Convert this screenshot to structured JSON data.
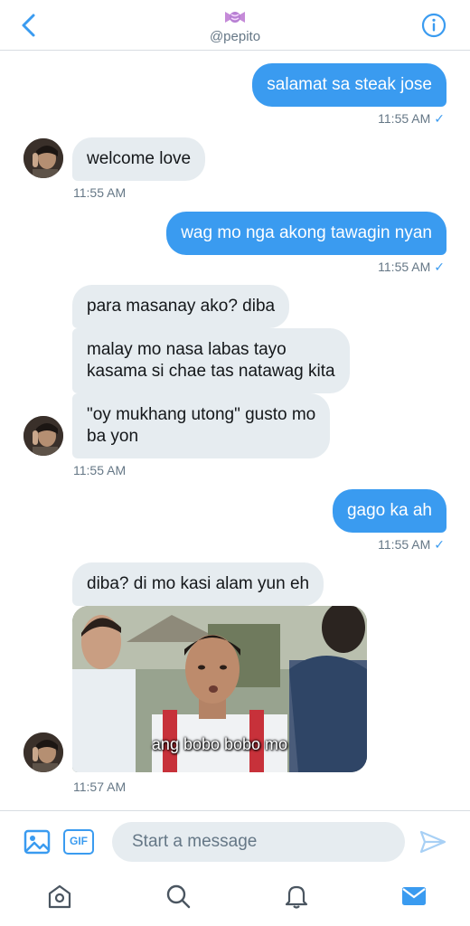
{
  "header": {
    "handle": "@pepito",
    "avatar_icon": "candy-emoji-icon"
  },
  "messages": [
    {
      "direction": "out",
      "text": "salamat sa steak jose",
      "time": "11:55 AM",
      "read": true
    },
    {
      "direction": "in",
      "text": "welcome love",
      "time": "11:55 AM"
    },
    {
      "direction": "out",
      "text": "wag mo nga akong tawagin nyan",
      "time": "11:55 AM",
      "read": true
    },
    {
      "direction": "in",
      "text": "para masanay ako? diba"
    },
    {
      "direction": "in",
      "lines": [
        "malay mo nasa labas tayo",
        "kasama si chae tas natawag kita"
      ]
    },
    {
      "direction": "in",
      "lines": [
        "\"oy mukhang utong\" gusto mo",
        "ba yon"
      ],
      "time": "11:55 AM"
    },
    {
      "direction": "out",
      "text": "gago ka ah",
      "time": "11:55 AM",
      "read": true
    },
    {
      "direction": "in",
      "text": "diba? di mo kasi alam yun eh"
    },
    {
      "direction": "in",
      "media_caption": "ang bobo bobo mo",
      "time": "11:57 AM"
    }
  ],
  "read_mark": "✓",
  "composer": {
    "placeholder": "Start a message",
    "gif_label": "GIF"
  },
  "nav": {
    "items": [
      "home-icon",
      "search-icon",
      "notifications-icon",
      "messages-icon"
    ],
    "active": "messages-icon"
  },
  "colors": {
    "accent": "#3a9bf0",
    "incoming_bubble": "#e6ecf0",
    "secondary_text": "#657786"
  }
}
